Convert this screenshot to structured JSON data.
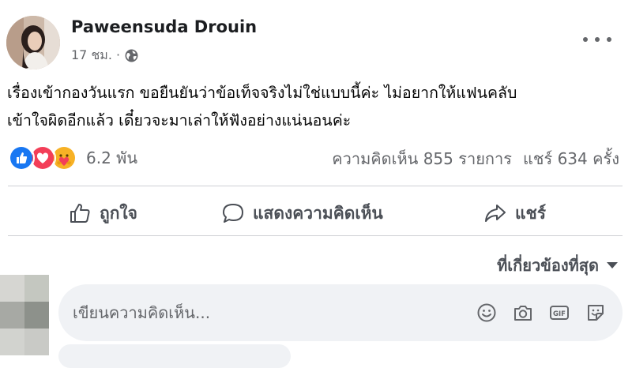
{
  "post": {
    "author": "Paweensuda Drouin",
    "time": "17 ชม. ·",
    "text_lines": [
      "เรื่องเข้ากองวันแรก ขอยืนยันว่าข้อเท็จจริงไม่ใช่แบบนี้ค่ะ ไม่อยากให้แฟนคลับ",
      "เข้าใจผิดอีกแล้ว เดี๋ยวจะมาเล่าให้ฟังอย่างแน่นอนค่ะ"
    ],
    "reaction_count": "6.2 พัน",
    "comments_count": "ความคิดเห็น 855 รายการ",
    "shares_count": "แชร์ 634 ครั้ง"
  },
  "actions": {
    "like": "ถูกใจ",
    "comment": "แสดงความคิดเห็น",
    "share": "แชร์"
  },
  "comments": {
    "sort_label": "ที่เกี่ยวข้องที่สุด",
    "placeholder": "เขียนความคิดเห็น..."
  },
  "icons": {
    "reactions": [
      "like-reaction-icon",
      "love-reaction-icon",
      "care-reaction-icon"
    ],
    "comment_tools": [
      "emoji-icon",
      "camera-icon",
      "gif-icon",
      "sticker-icon"
    ]
  },
  "colors": {
    "like_blue": "#1877f2",
    "love_red": "#f33e58",
    "care_yellow": "#f7b125",
    "muted_text": "#65676b"
  }
}
